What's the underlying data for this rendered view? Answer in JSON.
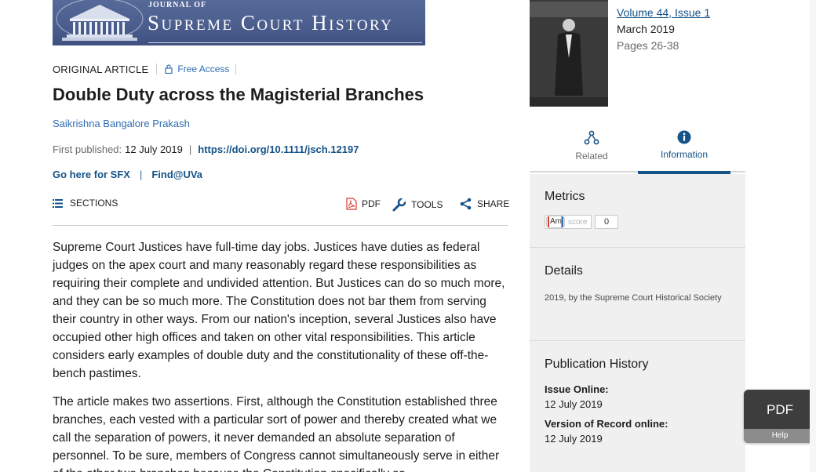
{
  "journal": {
    "name_small": "JOURNAL OF",
    "name_big": "Supreme Court History"
  },
  "article": {
    "type": "ORIGINAL ARTICLE",
    "access": "Free Access",
    "title": "Double Duty across the Magisterial Branches",
    "author": "Saikrishna Bangalore Prakash",
    "published_label": "First published:",
    "published_date": "12 July 2019",
    "doi": "https://doi.org/10.1111/jsch.12197",
    "link_sfx": "Go here for SFX",
    "link_find": "Find@UVa"
  },
  "toolbar": {
    "sections": "SECTIONS",
    "pdf": "PDF",
    "tools": "TOOLS",
    "share": "SHARE"
  },
  "body": {
    "p1": "Supreme Court Justices have full-time day jobs. Justices have duties as federal judges on the apex court and many reasonably regard these responsibilities as requiring their complete and undivided attention. But Justices can do so much more, and they can be so much more. The Constitution does not bar them from serving their country in other ways. From our nation's inception, several Justices also have occupied other high offices and taken on other vital responsibilities. This article considers early examples of double duty and the constitutionality of these off-the-bench pastimes.",
    "p2": "The article makes two assertions. First, although the Constitution established three branches, each vested with a particular sort of power and thereby created what we call the separation of powers, it never demanded an absolute separation of personnel. To be sure, members of Congress cannot simultaneously serve in either of the other two branches because the Constitution specifically so"
  },
  "issue": {
    "volume_label": "Volume",
    "volume": "44",
    "issue_label": "Issue",
    "issue": "1",
    "month": "March 2019",
    "pages": "Pages 26-38"
  },
  "tabs": {
    "related": "Related",
    "information": "Information"
  },
  "panel": {
    "metrics_title": "Metrics",
    "altmetric_badge": "Am",
    "altmetric_score_label": "score",
    "altmetric_score": "0",
    "details_title": "Details",
    "details_text": "2019, by the Supreme Court Historical Society",
    "history_title": "Publication History",
    "issue_online_label": "Issue Online:",
    "issue_online_date": "12 July 2019",
    "vor_label": "Version of Record online:",
    "vor_date": "12 July 2019"
  },
  "float_pdf": {
    "label": "PDF",
    "help": "Help"
  },
  "colors": {
    "link": "#155388",
    "link_light": "#2e6db4",
    "banner": "#4a5d8c",
    "panel_bg": "#f0f0f0"
  }
}
